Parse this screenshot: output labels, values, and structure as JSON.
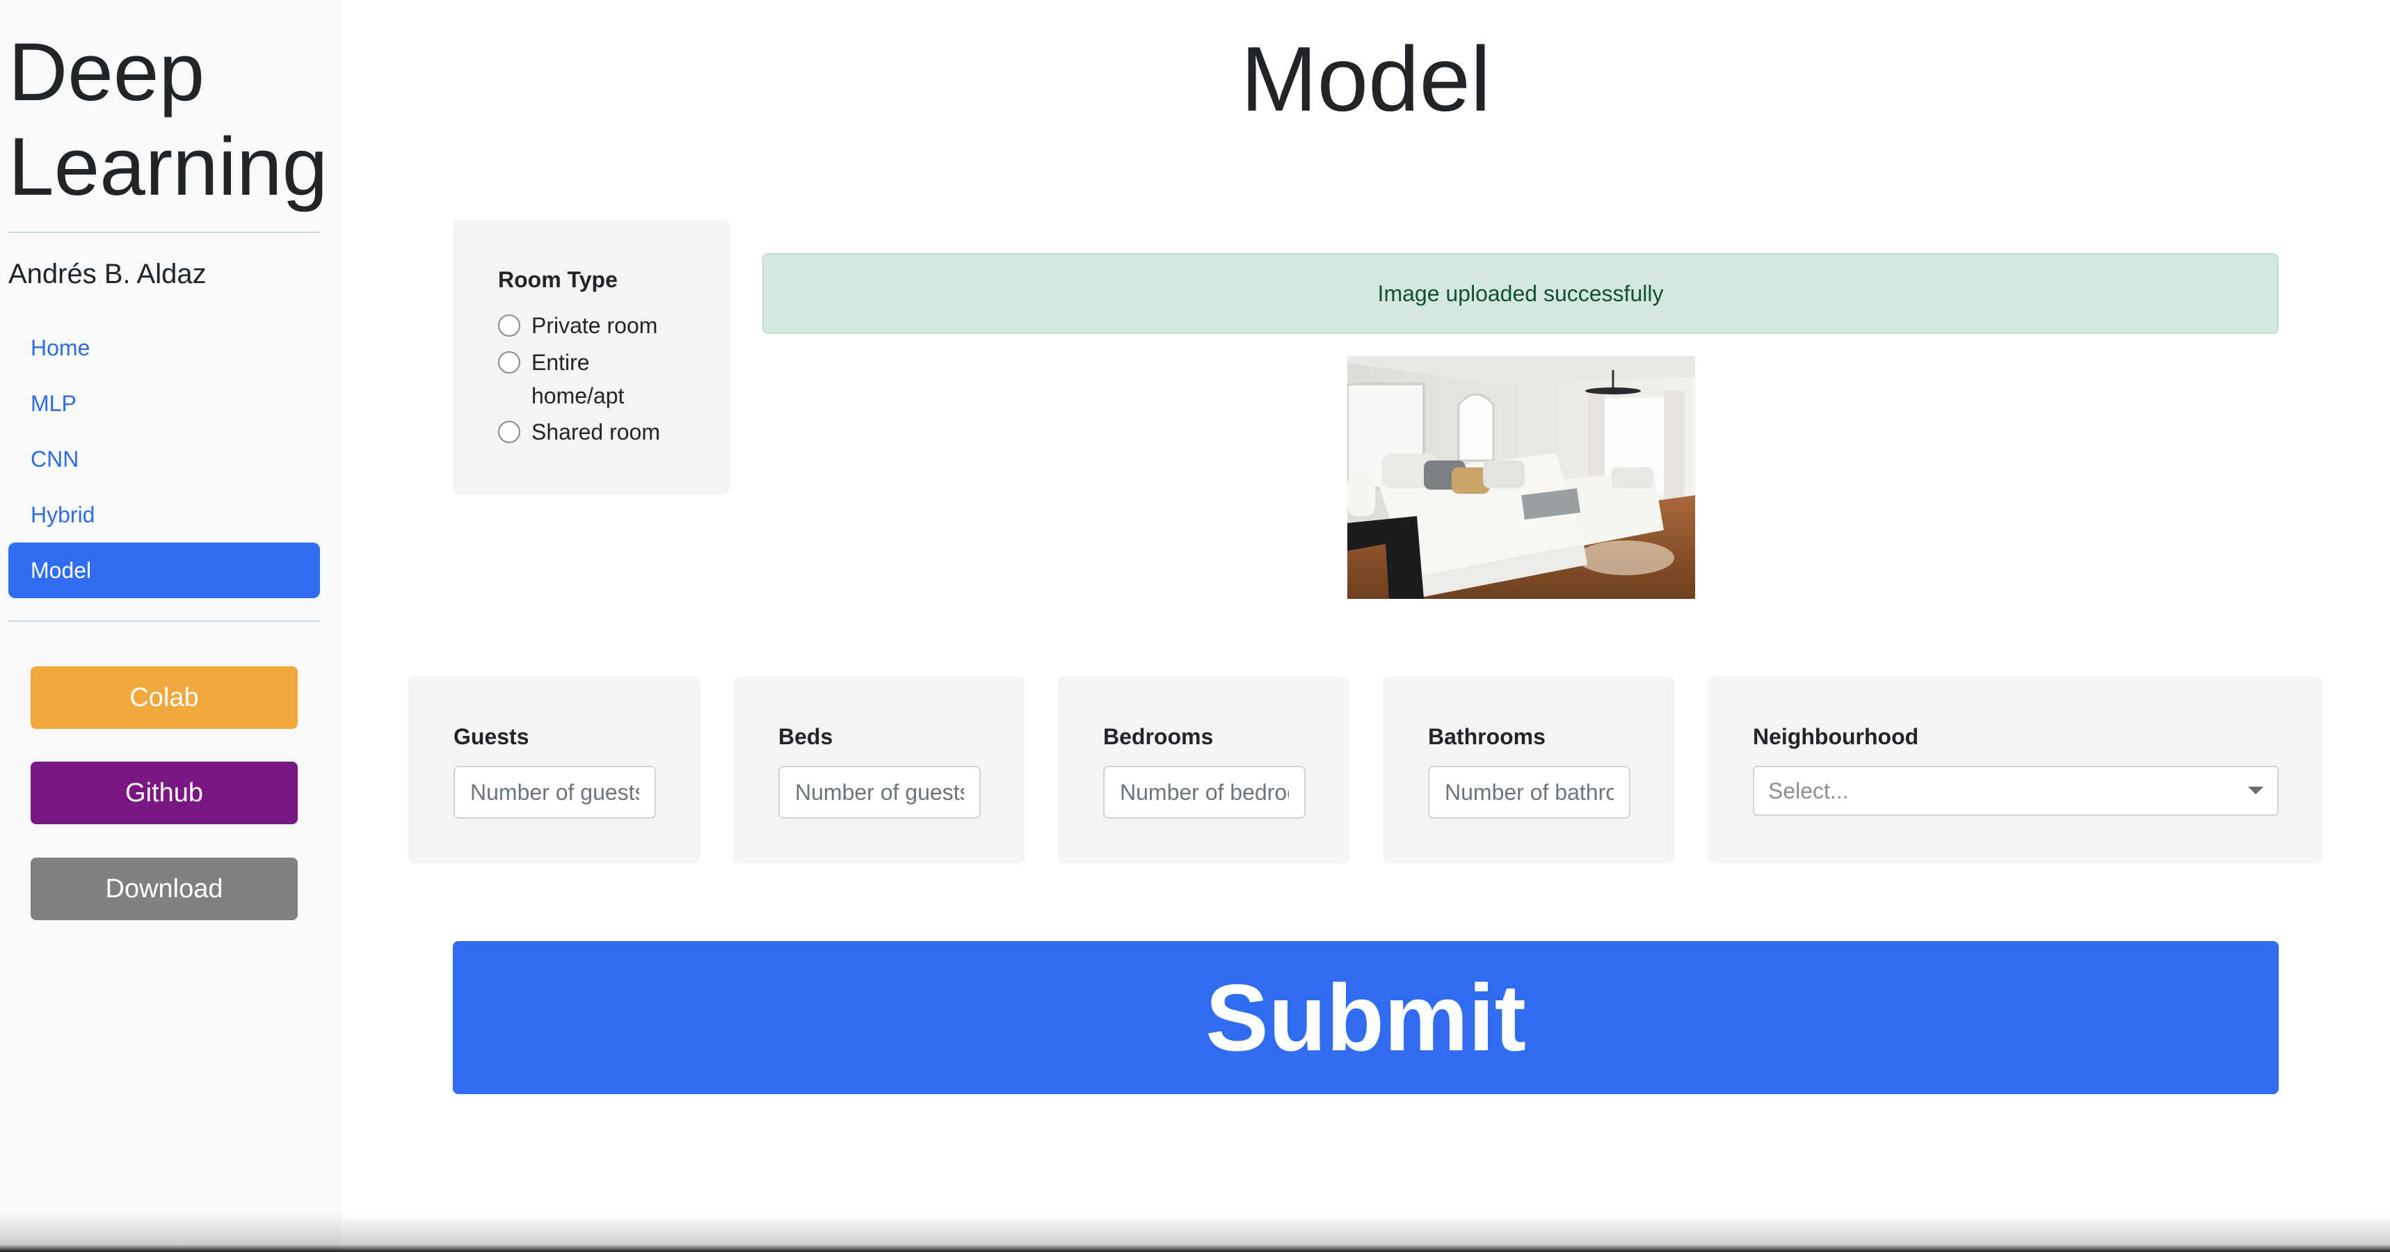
{
  "sidebar": {
    "brand_line1": "Deep",
    "brand_line2": "Learning",
    "author": "Andrés B. Aldaz",
    "nav": [
      {
        "label": "Home"
      },
      {
        "label": "MLP"
      },
      {
        "label": "CNN"
      },
      {
        "label": "Hybrid"
      },
      {
        "label": "Model",
        "active": true
      }
    ],
    "buttons": {
      "colab": "Colab",
      "github": "Github",
      "download": "Download"
    }
  },
  "main": {
    "title": "Model",
    "room_type": {
      "label": "Room Type",
      "options": [
        "Private room",
        "Entire home/apt",
        "Shared room"
      ]
    },
    "alert": "Image uploaded successfully",
    "fields": {
      "guests": {
        "label": "Guests",
        "placeholder": "Number of guests"
      },
      "beds": {
        "label": "Beds",
        "placeholder": "Number of guests"
      },
      "bedrooms": {
        "label": "Bedrooms",
        "placeholder": "Number of bedrooms"
      },
      "bathrooms": {
        "label": "Bathrooms",
        "placeholder": "Number of bathrooms"
      },
      "neighbourhood": {
        "label": "Neighbourhood",
        "placeholder": "Select..."
      }
    },
    "submit": "Submit"
  },
  "colors": {
    "primary": "#2f6cf0",
    "colab": "#f0a73c",
    "github": "#7b1783",
    "download": "#808080",
    "alert_bg": "#d4e8df"
  }
}
